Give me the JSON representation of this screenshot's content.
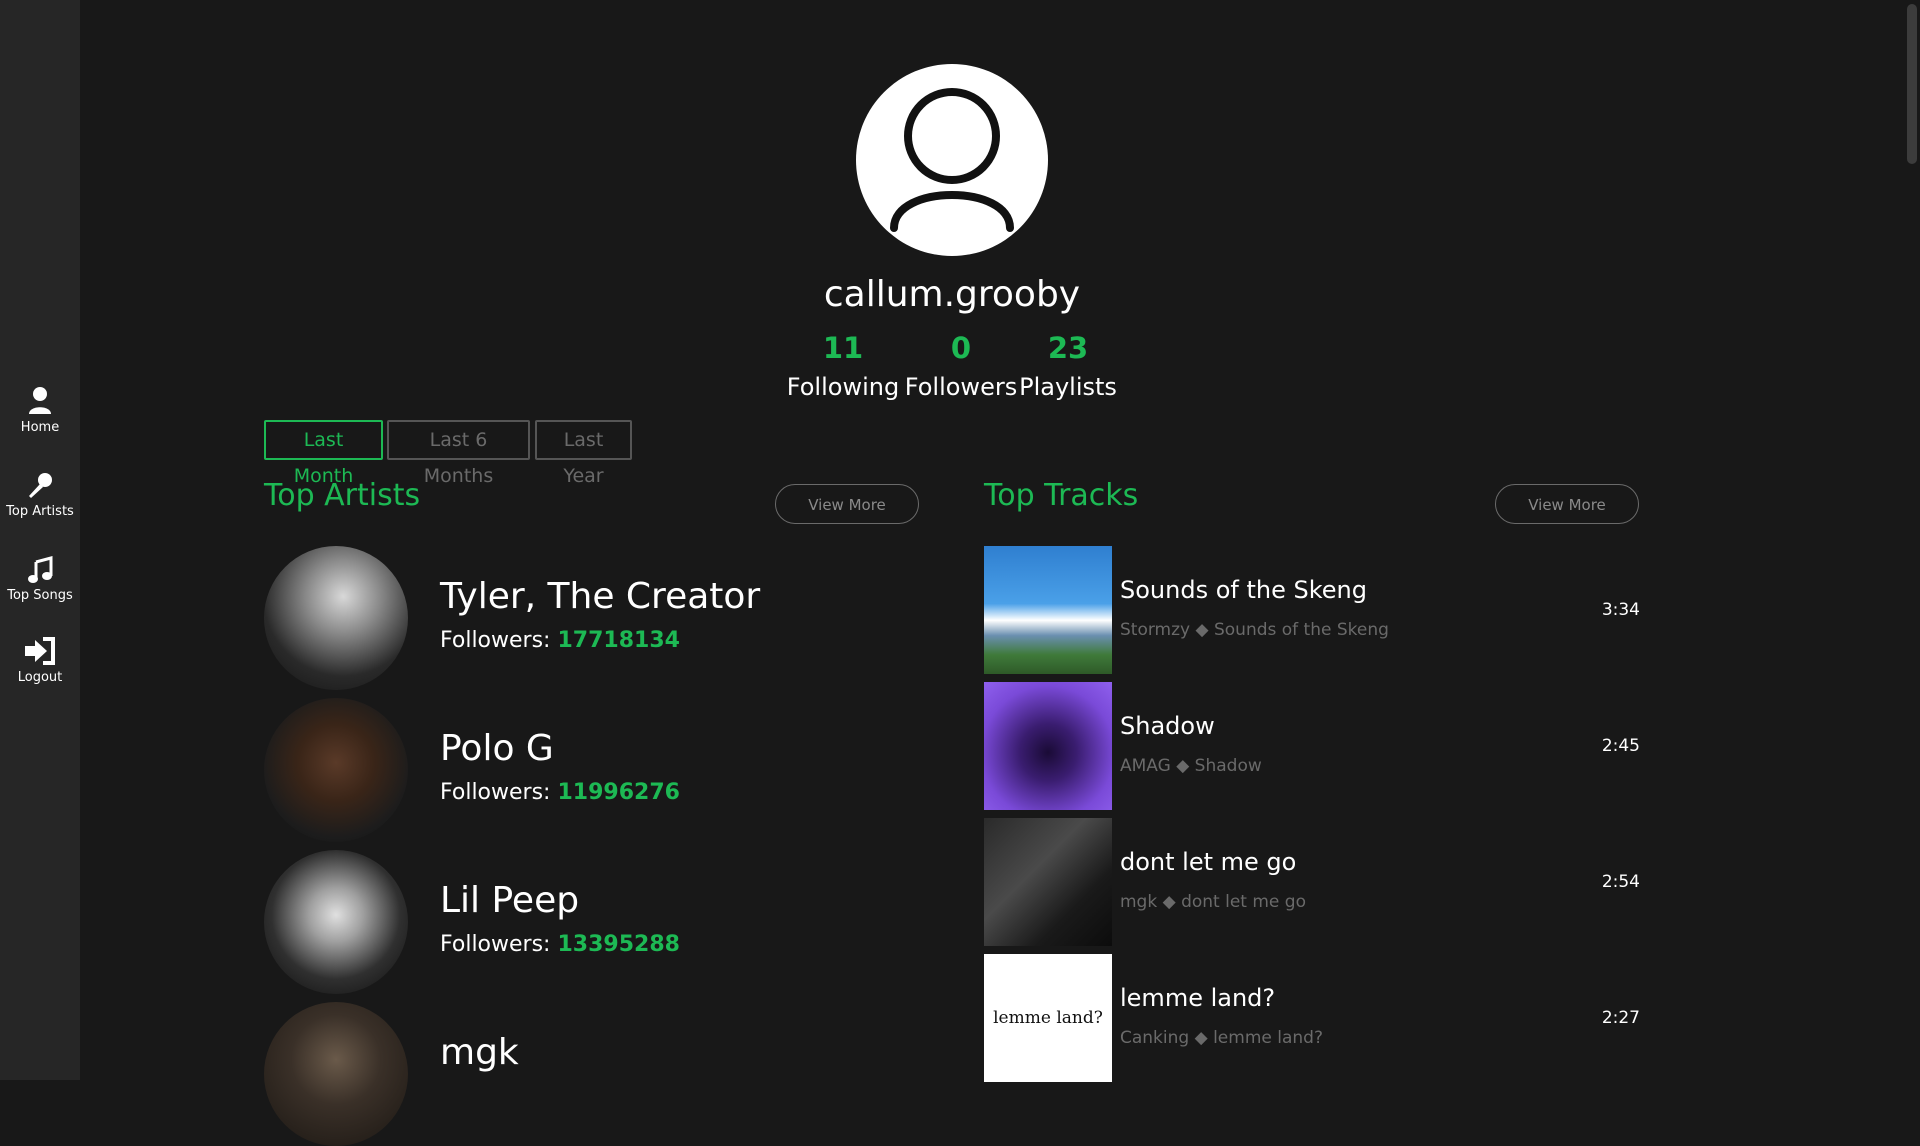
{
  "sidebar": {
    "items": [
      {
        "label": "Home",
        "icon": "user-icon"
      },
      {
        "label": "Top Artists",
        "icon": "microphone-icon"
      },
      {
        "label": "Top Songs",
        "icon": "music-note-icon"
      },
      {
        "label": "Logout",
        "icon": "sign-out-icon"
      }
    ]
  },
  "profile": {
    "username": "callum.grooby",
    "stats": [
      {
        "value": "11",
        "label": "Following"
      },
      {
        "value": "0",
        "label": "Followers"
      },
      {
        "value": "23",
        "label": "Playlists"
      }
    ]
  },
  "time_ranges": {
    "options": [
      "Last Month",
      "Last 6 Months",
      "Last Year"
    ],
    "selected": "Last Month"
  },
  "top_artists": {
    "title": "Top Artists",
    "view_more": "View More",
    "followers_label": "Followers:",
    "items": [
      {
        "name": "Tyler, The Creator",
        "followers": "17718134"
      },
      {
        "name": "Polo G",
        "followers": "11996276"
      },
      {
        "name": "Lil Peep",
        "followers": "13395288"
      },
      {
        "name": "mgk",
        "followers": ""
      }
    ]
  },
  "top_tracks": {
    "title": "Top Tracks",
    "view_more": "View More",
    "items": [
      {
        "title": "Sounds of the Skeng",
        "meta": "Stormzy ◆ Sounds of the Skeng",
        "duration": "3:34"
      },
      {
        "title": "Shadow",
        "meta": "AMAG ◆ Shadow",
        "duration": "2:45"
      },
      {
        "title": "dont let me go",
        "meta": "mgk ◆ dont let me go",
        "duration": "2:54"
      },
      {
        "title": "lemme land?",
        "meta": "Canking ◆ lemme land?",
        "duration": "2:27",
        "cover_text": "lemme land?"
      }
    ]
  },
  "colors": {
    "accent": "#1db954",
    "background": "#181818",
    "sidebar": "#262626"
  }
}
